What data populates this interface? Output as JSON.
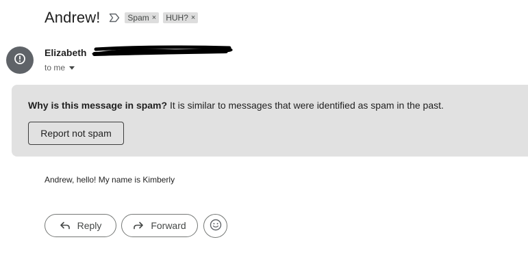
{
  "email": {
    "subject": "Andrew!",
    "labels": [
      {
        "name": "Spam",
        "close": "×"
      },
      {
        "name": "HUH?",
        "close": "×"
      }
    ],
    "sender": {
      "name": "Elizabeth",
      "recipient_text": "to me"
    },
    "spam_banner": {
      "heading": "Why is this message in spam?",
      "explanation": "It is similar to messages that were identified as spam in the past.",
      "button_label": "Report not spam"
    },
    "body": "Andrew, hello! My name is Kimberly",
    "actions": {
      "reply_label": "Reply",
      "forward_label": "Forward"
    }
  },
  "colors": {
    "avatar_bg": "#5f6368",
    "banner_bg": "#e1e1e1",
    "chip_bg": "#dddddd",
    "redaction": "#000000"
  },
  "icons": {
    "important_marker": "label-important-outline-icon",
    "avatar": "warning-circle-icon",
    "recipient_toggle": "caret-down-icon",
    "reply": "reply-arrow-icon",
    "forward": "forward-arrow-icon",
    "emoji": "smiley-face-icon"
  }
}
